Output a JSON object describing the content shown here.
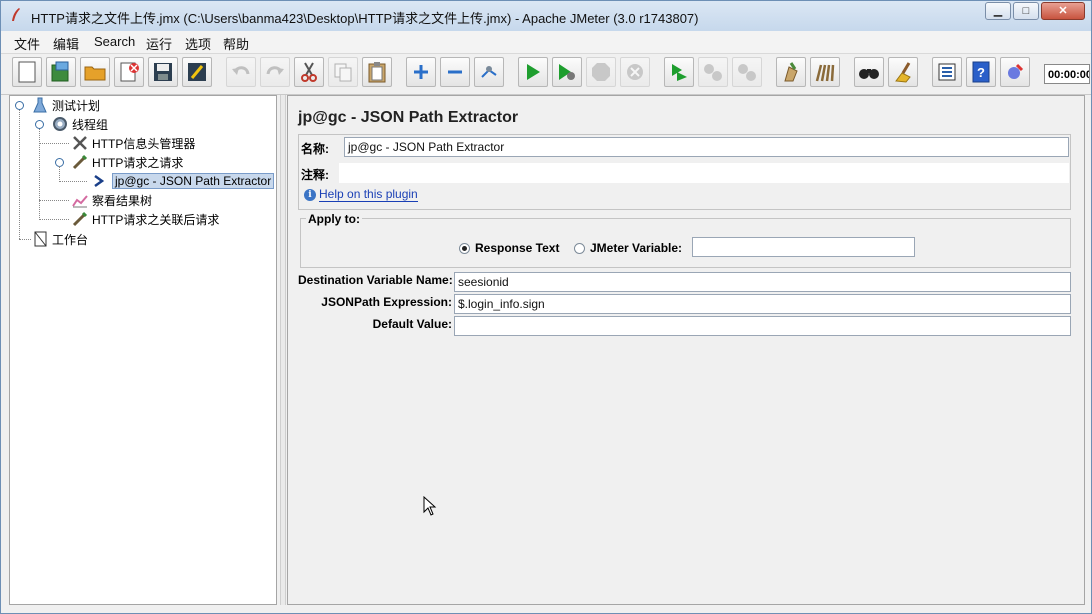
{
  "window": {
    "title": "HTTP请求之文件上传.jmx (C:\\Users\\banma423\\Desktop\\HTTP请求之文件上传.jmx) - Apache JMeter (3.0 r1743807)",
    "minimize": "▁",
    "maximize": "□",
    "close": "✕"
  },
  "menu": [
    "文件",
    "编辑",
    "Search",
    "运行",
    "选项",
    "帮助"
  ],
  "toolbar": {
    "timer": "00:00:00",
    "buttons": [
      "new-icon",
      "templates-icon",
      "open-icon",
      "close-plan-icon",
      "save-icon",
      "save-as-icon",
      "undo-icon",
      "redo-icon",
      "cut-icon",
      "copy-icon",
      "paste-icon",
      "expand-icon",
      "collapse-icon",
      "toggle-icon",
      "start-icon",
      "start-no-pause-icon",
      "stop-icon",
      "shutdown-icon",
      "remote-start-icon",
      "remote-stop-icon",
      "remote-shutdown-icon",
      "clear-icon",
      "clear-all-icon",
      "search-icon",
      "reset-search-icon",
      "function-helper-icon",
      "help-icon",
      "log-icon"
    ]
  },
  "tree": {
    "nodes": [
      {
        "label": "测试计划",
        "icon": "test-plan-icon"
      },
      {
        "label": "线程组",
        "icon": "thread-group-icon"
      },
      {
        "label": "HTTP信息头管理器",
        "icon": "header-manager-icon"
      },
      {
        "label": "HTTP请求之请求",
        "icon": "http-sampler-icon"
      },
      {
        "label": "jp@gc - JSON Path Extractor",
        "icon": "extractor-icon"
      },
      {
        "label": "察看结果树",
        "icon": "results-tree-icon"
      },
      {
        "label": "HTTP请求之关联后请求",
        "icon": "http-sampler-icon"
      },
      {
        "label": "工作台",
        "icon": "workbench-icon"
      }
    ]
  },
  "panel": {
    "title": "jp@gc - JSON Path Extractor",
    "name_label": "名称:",
    "name_value": "jp@gc - JSON Path Extractor",
    "comment_label": "注释:",
    "comment_value": "",
    "help_link": "Help on this plugin",
    "apply_to": {
      "legend": "Apply to:",
      "option1": "Response Text",
      "option2": "JMeter Variable:",
      "selected": "Response Text",
      "variable_value": ""
    },
    "dest_label": "Destination Variable Name:",
    "dest_value": "seesionid",
    "jsonpath_label": "JSONPath Expression:",
    "jsonpath_value": "$.login_info.sign",
    "default_label": "Default Value:",
    "default_value": ""
  }
}
